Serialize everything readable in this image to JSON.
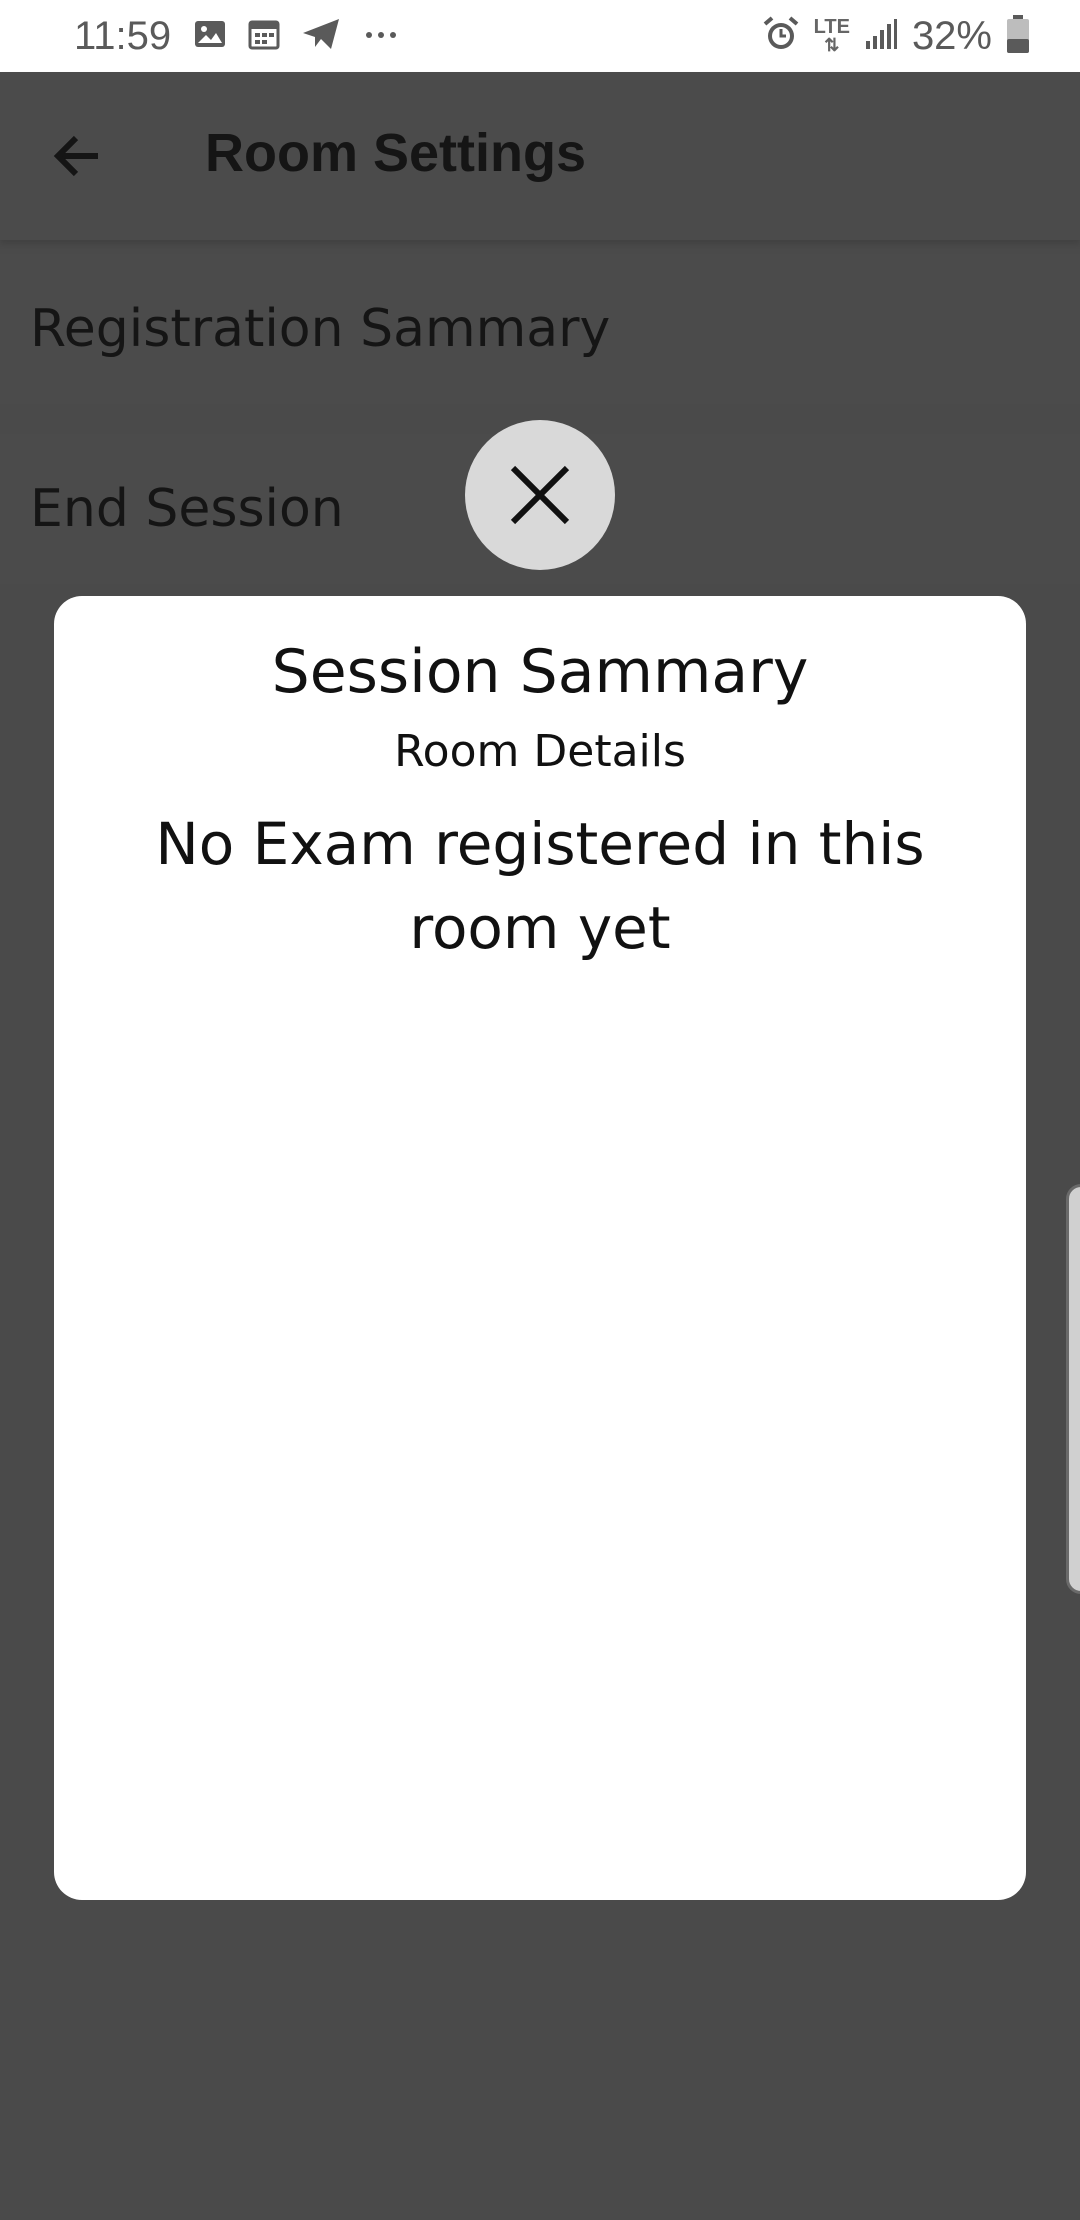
{
  "status_bar": {
    "time": "11:59",
    "left_icons": [
      "image-icon",
      "calendar-icon",
      "telegram-icon",
      "more-dots-icon"
    ],
    "network": "LTE",
    "battery": "32%",
    "right_icons": [
      "alarm-icon",
      "lte-icon",
      "signal-icon",
      "battery-icon"
    ]
  },
  "app_bar": {
    "title": "Room Settings",
    "back_icon": "arrow-left-icon"
  },
  "settings": {
    "items": [
      {
        "label": "Registration Sammary"
      },
      {
        "label": "End Session"
      }
    ]
  },
  "dialog": {
    "title": "Session Sammary",
    "subtitle": "Room Details",
    "message": "No Exam registered in this room yet",
    "close_icon": "close-icon"
  },
  "colors": {
    "scrim_background": "#4a4a4a",
    "dialog_background": "#ffffff",
    "close_button_background": "#d9d9d9",
    "status_bar_background": "#ffffff"
  }
}
